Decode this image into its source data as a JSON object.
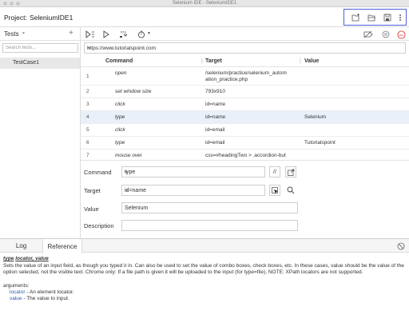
{
  "window": {
    "title": "Selenium IDE - SeleniumIDE1"
  },
  "project": {
    "label": "Project:",
    "name": "SeleniumIDE1"
  },
  "sidebar": {
    "header": "Tests",
    "search_placeholder": "Search tests...",
    "tests": [
      "TestCase1"
    ]
  },
  "url": {
    "value": "https://www.tutorialspoint.com"
  },
  "table": {
    "headers": [
      "Command",
      "Target",
      "Value"
    ],
    "rows": [
      {
        "num": "1",
        "command": "open",
        "target_line1": "/selenium/practice/selenium_autom",
        "target_line2": "ation_practice.php",
        "value": ""
      },
      {
        "num": "2",
        "command": "set window size",
        "target": "793x910",
        "value": ""
      },
      {
        "num": "3",
        "command": "click",
        "target": "id=name",
        "value": ""
      },
      {
        "num": "4",
        "command": "type",
        "target": "id=name",
        "value": "Selenium"
      },
      {
        "num": "5",
        "command": "click",
        "target": "id=email",
        "value": ""
      },
      {
        "num": "6",
        "command": "type",
        "target": "id=email",
        "value": "Tutorialspoint"
      },
      {
        "num": "7",
        "command": "mouse over",
        "target": "css=#headingTwo > .accordion-but",
        "value": ""
      }
    ]
  },
  "editor": {
    "command_label": "Command",
    "command_value": "type",
    "target_label": "Target",
    "target_value": "id=name",
    "value_label": "Value",
    "value_value": "Selenium",
    "description_label": "Description",
    "description_value": "",
    "comment_btn": "//"
  },
  "bottom": {
    "tabs": [
      "Log",
      "Reference"
    ],
    "active_tab": "Reference",
    "ref_command": "type",
    "ref_args_sig": "locator, value",
    "ref_description": "Sets the value of an input field, as though you typed it in. Can also be used to set the value of combo boxes, check boxes, etc. In these cases, value should be the value of the option selected, not the visible text. Chrome only: If a file path is given it will be uploaded to the input (for type=file), NOTE: XPath locators are not supported.",
    "arguments_label": "arguments:",
    "args": [
      {
        "name": "locator",
        "desc": " - An element locator."
      },
      {
        "name": "value",
        "desc": " - The value to input."
      }
    ]
  },
  "icons": {
    "record": "REC"
  },
  "colors": {
    "highlight_border": "#4a5fe0",
    "selected_row": "#e9f0fa",
    "record_red": "#e0403a"
  }
}
